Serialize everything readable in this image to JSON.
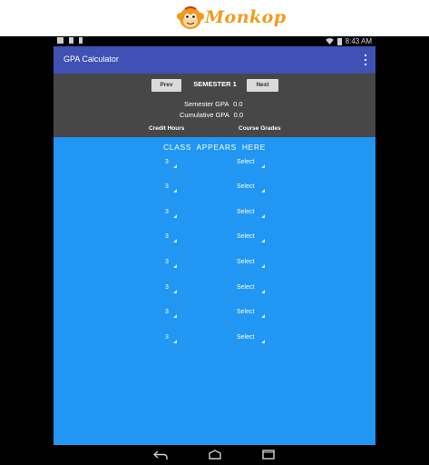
{
  "brand": {
    "name": "Monkop"
  },
  "status_bar": {
    "time": "8:43 AM"
  },
  "app_bar": {
    "title": "GPA Calculator",
    "overflow_icon": "more-vert-icon"
  },
  "semester_nav": {
    "prev_label": "Prev",
    "title": "SEMESTER 1",
    "next_label": "Next"
  },
  "gpa": {
    "semester_label": "Semester GPA",
    "semester_value": "0.0",
    "cumulative_label": "Cumulative GPA",
    "cumulative_value": "0.0"
  },
  "columns": {
    "credit_hours": "Credit Hours",
    "course_grades": "Course Grades"
  },
  "class_banner": "CLASS APPEARS HERE",
  "rows": [
    {
      "hours": "3",
      "grade": "Select"
    },
    {
      "hours": "3",
      "grade": "Select"
    },
    {
      "hours": "3",
      "grade": "Select"
    },
    {
      "hours": "3",
      "grade": "Select"
    },
    {
      "hours": "3",
      "grade": "Select"
    },
    {
      "hours": "3",
      "grade": "Select"
    },
    {
      "hours": "3",
      "grade": "Select"
    },
    {
      "hours": "3",
      "grade": "Select"
    }
  ],
  "colors": {
    "app_bar": "#3f51b5",
    "header_panel": "#474747",
    "content_bg": "#2196f3",
    "brand_accent": "#f39a1b"
  }
}
